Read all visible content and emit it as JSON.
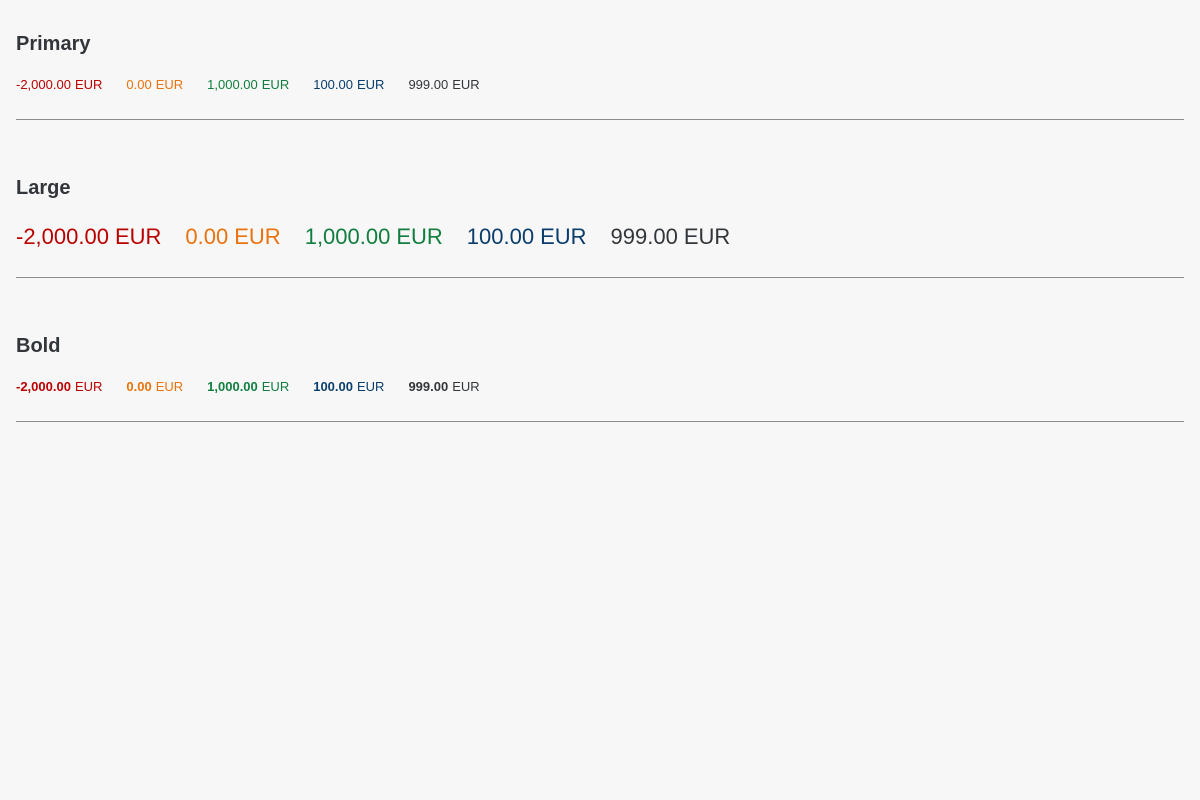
{
  "colors": {
    "error": "#bb0000",
    "critical": "#e9730c",
    "success": "#107e3e",
    "information": "#0a3d6b",
    "neutral": "#32363a",
    "divider": "#8c8c8c",
    "background": "#f7f7f7"
  },
  "sections": [
    {
      "title": "Primary",
      "numbers": [
        {
          "value": "-2,000.00",
          "unit": "EUR"
        },
        {
          "value": "0.00",
          "unit": "EUR"
        },
        {
          "value": "1,000.00",
          "unit": "EUR"
        },
        {
          "value": "100.00",
          "unit": "EUR"
        },
        {
          "value": "999.00",
          "unit": "EUR"
        }
      ]
    },
    {
      "title": "Large",
      "numbers": [
        {
          "value": "-2,000.00",
          "unit": "EUR"
        },
        {
          "value": "0.00",
          "unit": "EUR"
        },
        {
          "value": "1,000.00",
          "unit": "EUR"
        },
        {
          "value": "100.00",
          "unit": "EUR"
        },
        {
          "value": "999.00",
          "unit": "EUR"
        }
      ]
    },
    {
      "title": "Bold",
      "numbers": [
        {
          "value": "-2,000.00",
          "unit": "EUR"
        },
        {
          "value": "0.00",
          "unit": "EUR"
        },
        {
          "value": "1,000.00",
          "unit": "EUR"
        },
        {
          "value": "100.00",
          "unit": "EUR"
        },
        {
          "value": "999.00",
          "unit": "EUR"
        }
      ]
    }
  ]
}
